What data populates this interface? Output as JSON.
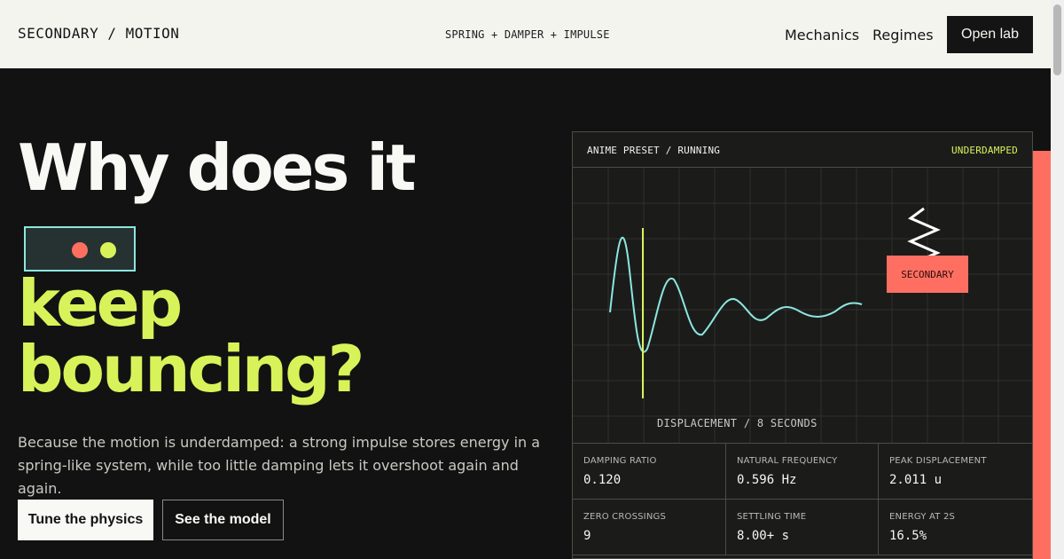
{
  "header": {
    "brand": "SECONDARY / MOTION",
    "tagline": "SPRING + DAMPER + IMPULSE",
    "nav": [
      {
        "label": "Mechanics"
      },
      {
        "label": "Regimes"
      }
    ],
    "cta_label": "Open lab"
  },
  "hero": {
    "title_line1": "Why does it",
    "title_line2": "keep",
    "title_line3": "bouncing?",
    "description": "Because the motion is underdamped: a strong impulse stores energy in a spring-like system, while too little damping lets it overshoot again and again.",
    "primary_button": "Tune the physics",
    "secondary_button": "See the model"
  },
  "lab": {
    "title": "ANIME PRESET / RUNNING",
    "state": "UNDERDAMPED",
    "mass_label": "SECONDARY",
    "caption": "DISPLACEMENT / 8 SECONDS",
    "stats": [
      {
        "label": "DAMPING RATIO",
        "value": "0.120"
      },
      {
        "label": "NATURAL FREQUENCY",
        "value": "0.596 Hz"
      },
      {
        "label": "PEAK DISPLACEMENT",
        "value": "2.011 u"
      },
      {
        "label": "ZERO CROSSINGS",
        "value": "9"
      },
      {
        "label": "SETTLING TIME",
        "value": "8.00+ s"
      },
      {
        "label": "ENERGY AT 2S",
        "value": "16.5%"
      }
    ]
  },
  "colors": {
    "background": "#121212",
    "accent_lime": "#d8f35a",
    "accent_coral": "#ff6f61",
    "accent_cyan": "#8de6e0",
    "paper": "#f4f4ef"
  },
  "icons": {
    "face_icon": "two-dot-face-icon"
  }
}
